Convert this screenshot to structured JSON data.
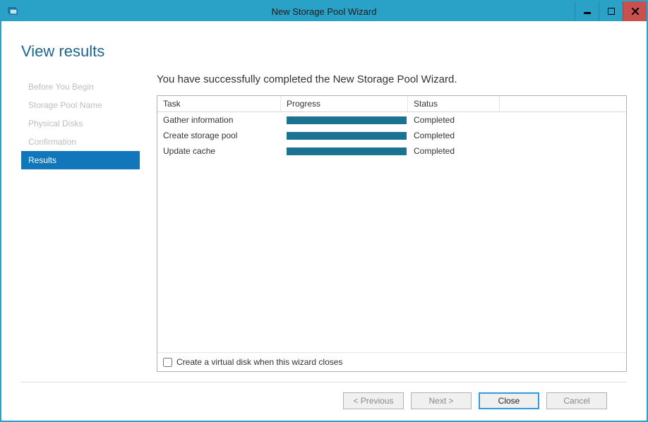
{
  "window": {
    "title": "New Storage Pool Wizard"
  },
  "heading": "View results",
  "sidebar": {
    "items": [
      {
        "label": "Before You Begin"
      },
      {
        "label": "Storage Pool Name"
      },
      {
        "label": "Physical Disks"
      },
      {
        "label": "Confirmation"
      },
      {
        "label": "Results"
      }
    ]
  },
  "main": {
    "message": "You have successfully completed the New Storage Pool Wizard.",
    "columns": {
      "task": "Task",
      "progress": "Progress",
      "status": "Status"
    },
    "rows": [
      {
        "task": "Gather information",
        "status": "Completed"
      },
      {
        "task": "Create storage pool",
        "status": "Completed"
      },
      {
        "task": "Update cache",
        "status": "Completed"
      }
    ],
    "checkbox_label": "Create a virtual disk when this wizard closes"
  },
  "footer": {
    "previous": "< Previous",
    "next": "Next >",
    "close": "Close",
    "cancel": "Cancel"
  }
}
